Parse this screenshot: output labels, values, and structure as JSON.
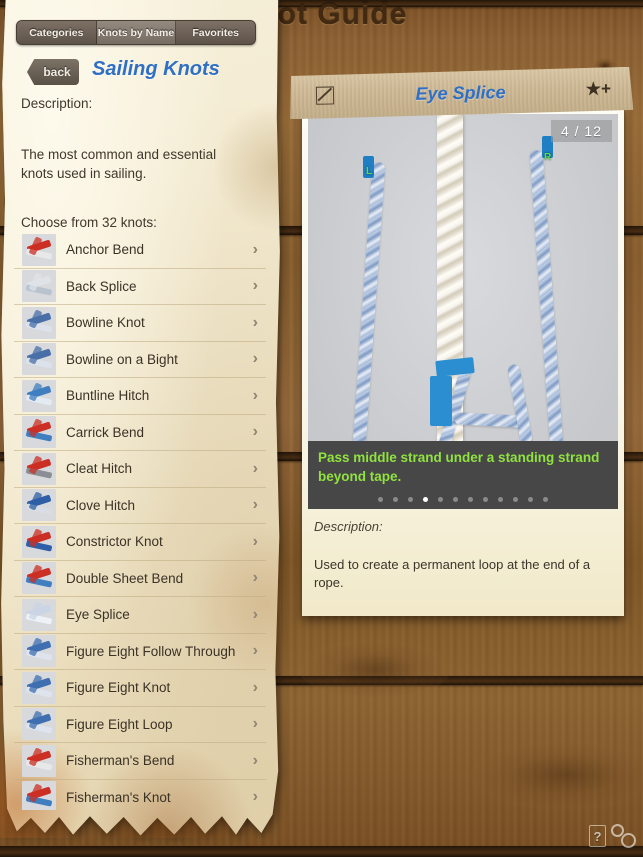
{
  "app": {
    "title": "Knot Guide"
  },
  "tabs": [
    {
      "label": "Categories",
      "selected": false
    },
    {
      "label": "Knots by Name",
      "selected": true
    },
    {
      "label": "Favorites",
      "selected": false
    }
  ],
  "left": {
    "back_label": "back",
    "category_title": "Sailing Knots",
    "description_label": "Description:",
    "description_text": "The most common and essential knots used in sailing.",
    "choose_label": "Choose from 32 knots:",
    "chevron": "›",
    "knots": [
      {
        "name": "Anchor Bend"
      },
      {
        "name": "Back Splice"
      },
      {
        "name": "Bowline Knot"
      },
      {
        "name": "Bowline on a Bight"
      },
      {
        "name": "Buntline Hitch"
      },
      {
        "name": "Carrick Bend"
      },
      {
        "name": "Cleat Hitch"
      },
      {
        "name": "Clove Hitch"
      },
      {
        "name": "Constrictor Knot"
      },
      {
        "name": "Double Sheet Bend"
      },
      {
        "name": "Eye Splice"
      },
      {
        "name": "Figure Eight Follow Through"
      },
      {
        "name": "Figure Eight Knot"
      },
      {
        "name": "Figure Eight Loop"
      },
      {
        "name": "Fisherman's Bend"
      },
      {
        "name": "Fisherman's Knot"
      }
    ]
  },
  "detail": {
    "title": "Eye Splice",
    "edit_icon": "edit-icon",
    "favorite_icon": "★+",
    "counter": "4 / 12",
    "step_current": 4,
    "step_total": 12,
    "caption": "Pass middle strand under a standing strand beyond tape.",
    "description_label": "Description:",
    "description_text": "Used to create a permanent loop at the end of a rope.",
    "photo_labels": {
      "left": "L",
      "right": "R"
    }
  },
  "bottom": {
    "help_label": "?",
    "settings_icon": "gears-icon"
  },
  "colors": {
    "accent_blue": "#2f6fc4",
    "caption_green": "#8fe33f",
    "wood": "#8a6035",
    "paper": "#f3ead0"
  }
}
